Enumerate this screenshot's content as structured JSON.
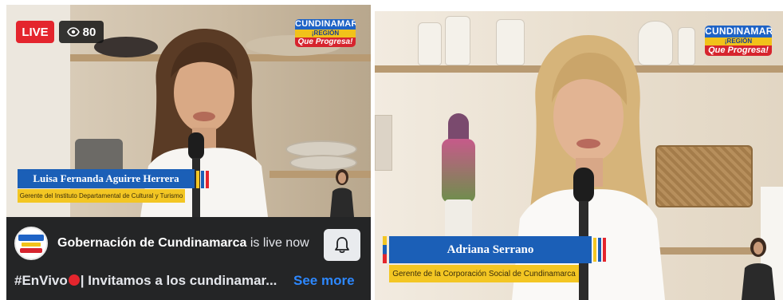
{
  "left_stream": {
    "live_label": "LIVE",
    "viewer_count": "80",
    "logo": {
      "line1": "CUNDINAMARCA",
      "line2": "¡REGIÓN",
      "line3": "Que Progresa!"
    },
    "lower_third": {
      "name": "Luisa Fernanda Aguirre Herrera",
      "title": "Gerente del Instituto Departamental de Cultural y Turismo"
    },
    "channel_name": "Gobernación de Cundinamarca",
    "live_now_text": "is live now",
    "caption_hashtag": "#EnVivo",
    "caption_text": "| Invitamos a los cundinamar...",
    "see_more_label": "See more"
  },
  "right_stream": {
    "logo": {
      "line1": "CUNDINAMARCA",
      "line2": "¡REGIÓN",
      "line3": "Que Progresa!"
    },
    "lower_third": {
      "name": "Adriana Serrano",
      "title": "Gerente de la Corporación Social de Cundinamarca"
    }
  },
  "colors": {
    "live_red": "#e4252d",
    "brand_blue": "#1b5fb7",
    "brand_yellow": "#f3c623",
    "link_blue": "#2d88ff"
  }
}
